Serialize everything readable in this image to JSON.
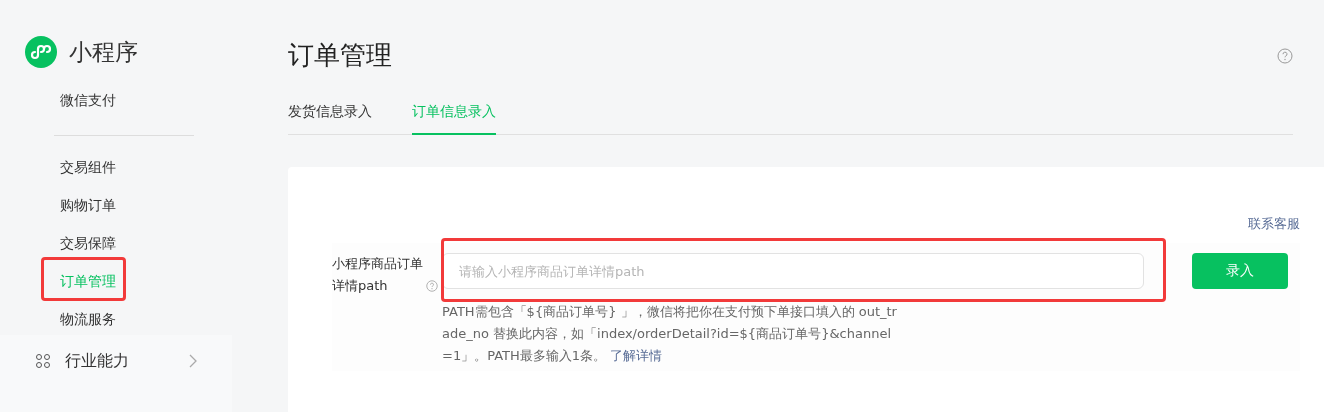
{
  "app": {
    "title": "小程序"
  },
  "sidebar": {
    "items": [
      {
        "label": "微信支付",
        "selected": false,
        "highlighted": false,
        "kind": "plain"
      },
      {
        "kind": "divider"
      },
      {
        "label": "交易组件",
        "selected": false,
        "highlighted": false,
        "kind": "plain"
      },
      {
        "label": "购物订单",
        "selected": false,
        "highlighted": false,
        "kind": "plain"
      },
      {
        "label": "交易保障",
        "selected": false,
        "highlighted": false,
        "kind": "plain"
      },
      {
        "label": "订单管理",
        "selected": true,
        "highlighted": true,
        "kind": "plain"
      },
      {
        "label": "物流服务",
        "selected": false,
        "highlighted": false,
        "kind": "plain"
      },
      {
        "label": "行业能力",
        "kind": "group",
        "expanded": false
      }
    ]
  },
  "page": {
    "title": "订单管理"
  },
  "tabs": [
    {
      "label": "发货信息录入",
      "selected": false
    },
    {
      "label": "订单信息录入",
      "selected": true
    }
  ],
  "form": {
    "contact_link": "联系客服",
    "field": {
      "label": "小程序商品订单详情path",
      "placeholder": "请输入小程序商品订单详情path",
      "highlighted": true,
      "hint": "PATH需包含「${商品订单号} 」，微信将把你在支付预下单接口填入的 out_trade_no 替换此内容，如「index/orderDetail?id=${商品订单号}&channel=1」。PATH最多输入1条。",
      "hint_link": "了解详情"
    },
    "submit": "录入"
  }
}
